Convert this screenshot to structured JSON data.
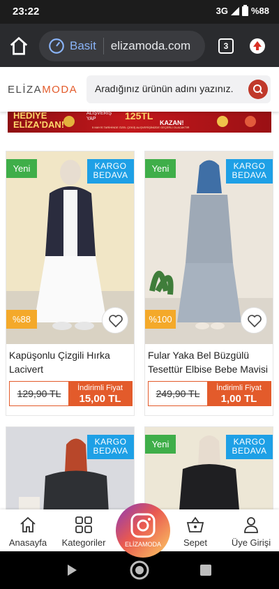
{
  "status_bar": {
    "time": "23:22",
    "network": "3G",
    "battery": "%88"
  },
  "browser": {
    "security_label": "Basit",
    "url": "elizamoda.com",
    "tab_count": "3"
  },
  "site": {
    "logo_part1": "ELİZA",
    "logo_part2": "MODA",
    "search_placeholder": "Aradığınız ürünün adını yazınız."
  },
  "banner": {
    "line1": "HEDİYE",
    "line2": "ELİZA'DAN!",
    "small1": "ALIŞVERİŞ",
    "small2": "YAP",
    "amount": "125TL",
    "win": "KAZAN!",
    "fine_print": "5 MAYIS TARİHİNDE ÖZEL ÇEKİŞ ALIŞVERİŞİNİZDE GEÇERLİ OLACAKTIR"
  },
  "products": [
    {
      "name": "Kapüşonlu Çizgili Hırka Lacivert",
      "new_badge": "Yeni",
      "cargo_line1": "KARGO",
      "cargo_line2": "BEDAVA",
      "discount": "%88",
      "old_price": "129,90 TL",
      "price_label": "İndirimli Fiyat",
      "price": "15,00 TL"
    },
    {
      "name": "Fular Yaka Bel Büzgülü Tesettür Elbise Bebe Mavisi",
      "new_badge": "Yeni",
      "cargo_line1": "KARGO",
      "cargo_line2": "BEDAVA",
      "discount": "%100",
      "old_price": "249,90 TL",
      "price_label": "İndirimli Fiyat",
      "price": "1,00 TL"
    },
    {
      "cargo_line1": "KARGO",
      "cargo_line2": "BEDAVA"
    },
    {
      "new_badge": "Yeni",
      "cargo_line1": "KARGO",
      "cargo_line2": "BEDAVA"
    }
  ],
  "bottom_nav": {
    "home": "Anasayfa",
    "categories": "Kategoriler",
    "center": "ELİZAMODA",
    "cart": "Sepet",
    "login": "Üye Girişi"
  },
  "colors": {
    "accent_orange": "#e35b2b",
    "new_green": "#3fae49",
    "cargo_blue": "#1ea0e6",
    "discount_yellow": "#f4a92a"
  }
}
